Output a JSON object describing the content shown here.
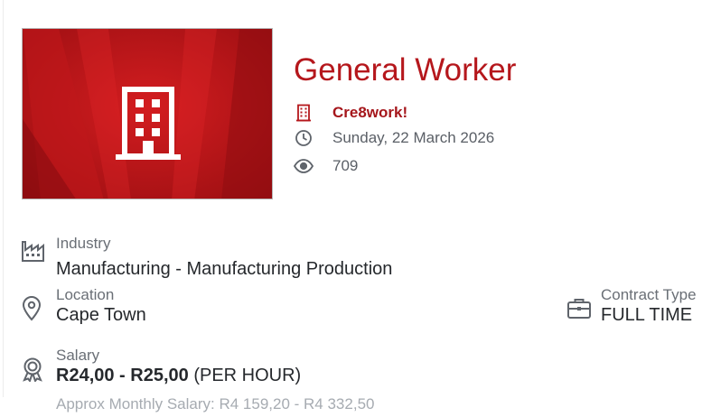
{
  "job": {
    "title": "General Worker",
    "company": "Cre8work!",
    "date": "Sunday, 22 March 2026",
    "views": "709"
  },
  "details": {
    "industry_label": "Industry",
    "industry_value": "Manufacturing - Manufacturing Production",
    "location_label": "Location",
    "location_value": "Cape Town",
    "contract_label": "Contract Type",
    "contract_value": "FULL TIME",
    "salary_label": "Salary",
    "salary_range": "R24,00 - R25,00",
    "salary_period": "(PER HOUR)",
    "approx_monthly": "Approx Monthly Salary: R4 159,20 - R4 332,50"
  },
  "icons": {
    "banner": "building-icon",
    "company": "building-icon",
    "date": "clock-icon",
    "views": "eye-icon",
    "industry": "factory-icon",
    "location": "map-pin-icon",
    "contract": "briefcase-icon",
    "salary": "award-ribbon-icon"
  },
  "colors": {
    "accent": "#b5171c",
    "banner_red": "#b81418",
    "muted_text": "#6a6f76"
  }
}
